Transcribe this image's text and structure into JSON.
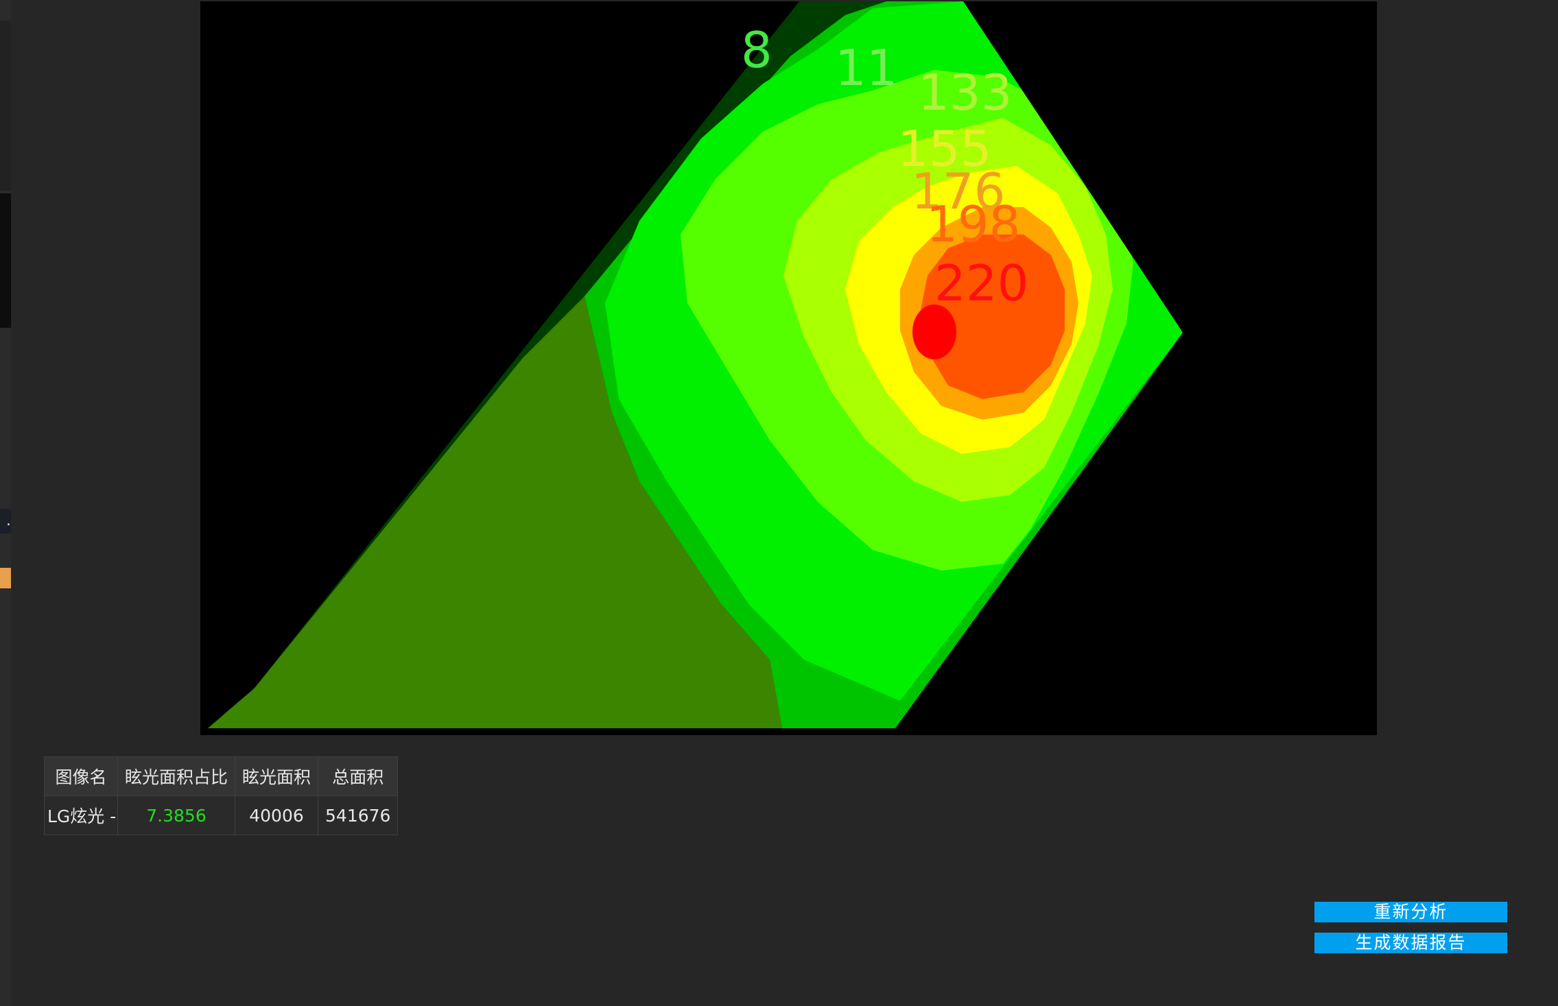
{
  "heatmap": {
    "contour_labels": [
      "8",
      "11",
      "133",
      "155",
      "176",
      "198",
      "220"
    ],
    "colors": {
      "dark_green": "#003d00",
      "olive": "#3b8500",
      "green": "#00c400",
      "bright_green": "#00f000",
      "lime": "#55ff00",
      "yellow_green": "#aaff00",
      "yellow": "#ffff00",
      "orange": "#ffa500",
      "red_orange": "#ff5500",
      "red": "#ff0000"
    }
  },
  "table": {
    "headers": [
      "图像名",
      "眩光面积占比",
      "眩光面积",
      "总面积"
    ],
    "row": {
      "name": "LG炫光 -",
      "ratio": "7.3856",
      "glare_area": "40006",
      "total_area": "541676"
    }
  },
  "buttons": {
    "reanalyze": "重新分析",
    "report": "生成数据报告"
  }
}
